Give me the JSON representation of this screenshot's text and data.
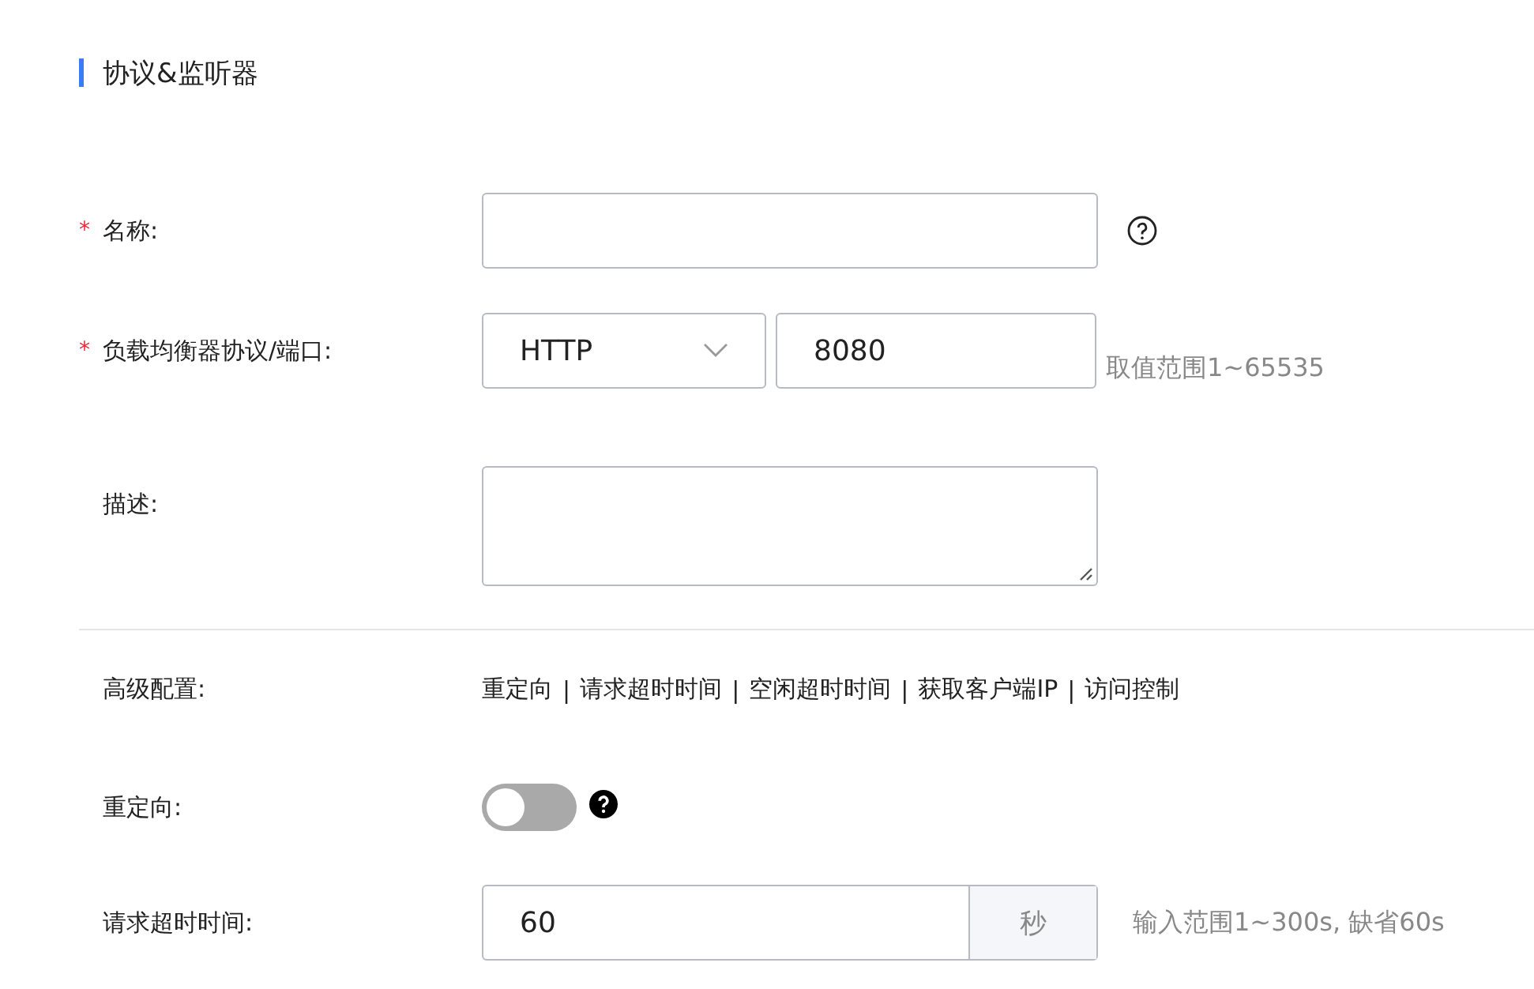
{
  "section": {
    "title": "协议&监听器"
  },
  "name": {
    "label": "名称:",
    "required_mark": "*"
  },
  "protocol": {
    "label": "负载均衡器协议/端口:",
    "required_mark": "*",
    "value": "HTTP",
    "port": "8080",
    "hint": "取值范围1~65535"
  },
  "description": {
    "label": "描述:"
  },
  "advanced": {
    "label": "高级配置:",
    "links": [
      {
        "label": "重定向"
      },
      {
        "label": "请求超时时间"
      },
      {
        "label": "空闲超时时间"
      },
      {
        "label": "获取客户端IP"
      },
      {
        "label": "访问控制"
      }
    ],
    "separators": [
      "|",
      "|",
      "|",
      "|"
    ]
  },
  "redirect": {
    "label": "重定向:",
    "on": false
  },
  "timeout": {
    "label": "请求超时时间:",
    "value": "60",
    "unit": "秒",
    "hint": "输入范围1~300s, 缺省60s"
  }
}
